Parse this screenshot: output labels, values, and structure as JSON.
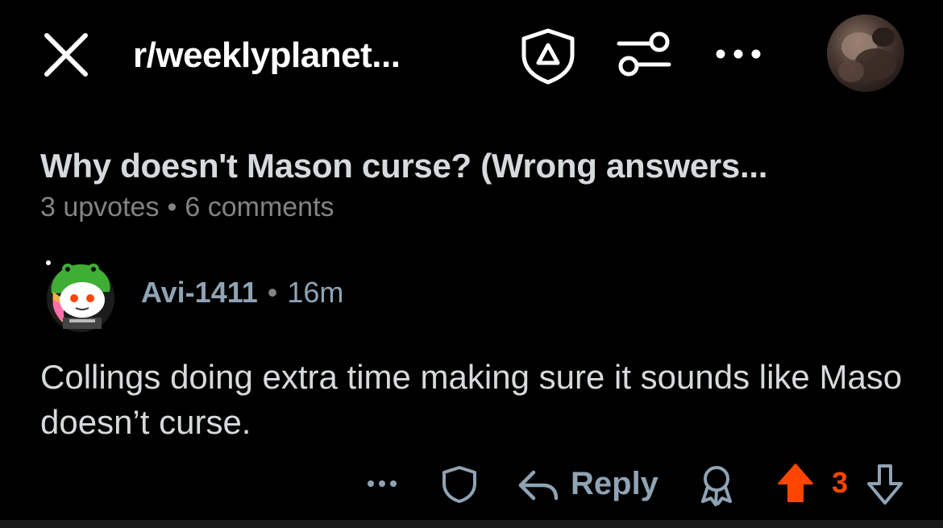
{
  "header": {
    "subreddit": "r/weeklyplanet...",
    "icons": [
      "close-icon",
      "mod-shield-icon",
      "filter-sliders-icon",
      "more-icon",
      "user-avatar"
    ]
  },
  "post": {
    "title": "Why doesn't Mason curse? (Wrong answers...",
    "upvotes": "3 upvotes",
    "separator": "•",
    "comments": "6 comments"
  },
  "comment": {
    "author": "Avi-1411",
    "separator": "•",
    "time": "16m",
    "body": "Collings doing extra time making sure it sounds like Maso doesn’t curse.",
    "actions": {
      "reply_label": "Reply",
      "vote_count": "3"
    }
  },
  "colors": {
    "background": "#000000",
    "text": "#d7dadc",
    "muted": "#818384",
    "link": "#8fa3b4",
    "upvote": "#ff4500"
  }
}
